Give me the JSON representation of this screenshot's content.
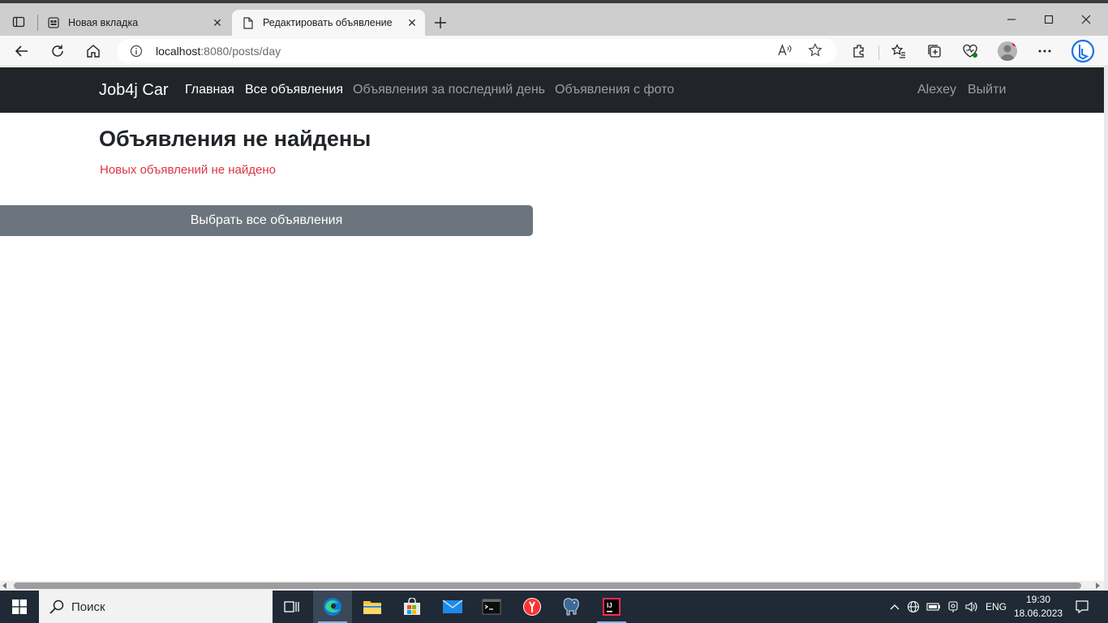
{
  "browser": {
    "tabs": [
      {
        "title": "Новая вкладка",
        "active": false
      },
      {
        "title": "Редактировать объявление",
        "active": true
      }
    ],
    "address": {
      "host": "localhost",
      "path": ":8080/posts/day"
    }
  },
  "navbar": {
    "brand": "Job4j Car",
    "links": [
      "Главная",
      "Все объявления",
      "Объявления за последний день",
      "Объявления с фото"
    ],
    "user": "Alexey",
    "logout": "Выйти"
  },
  "main": {
    "heading": "Объявления не найдены",
    "message": "Новых объявлений не найдено",
    "button": "Выбрать все объявления"
  },
  "taskbar": {
    "search_label": "Поиск",
    "language": "ENG",
    "time": "19:30",
    "date": "18.06.2023"
  },
  "colors": {
    "navbar_bg": "#212529",
    "error_text": "#dc3545",
    "button_bg": "#6c757d"
  }
}
